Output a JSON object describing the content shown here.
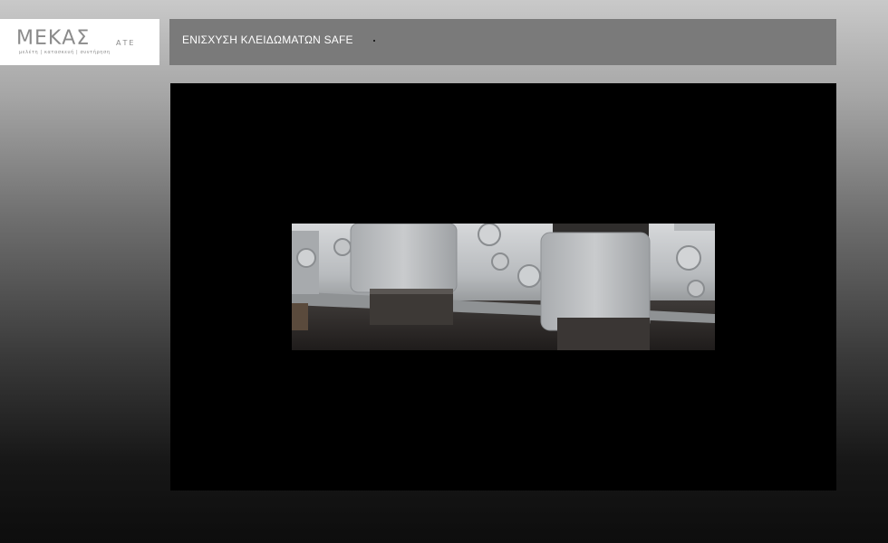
{
  "logo": {
    "word": "ΜΕΚΑΣ",
    "suffix": "ΑΤΕ",
    "tagline": "μελέτη | κατασκευή | συντήρηση"
  },
  "header": {
    "title": "ΕΝΙΣΧΥΣΗ ΚΛΕΙΔΩΜΑΤΩΝ SAFE"
  },
  "image": {
    "subject": "bolted steel locking brackets",
    "colors": {
      "steel": "#b9bcbf",
      "dark": "#3a3634",
      "background": "#000000"
    }
  }
}
